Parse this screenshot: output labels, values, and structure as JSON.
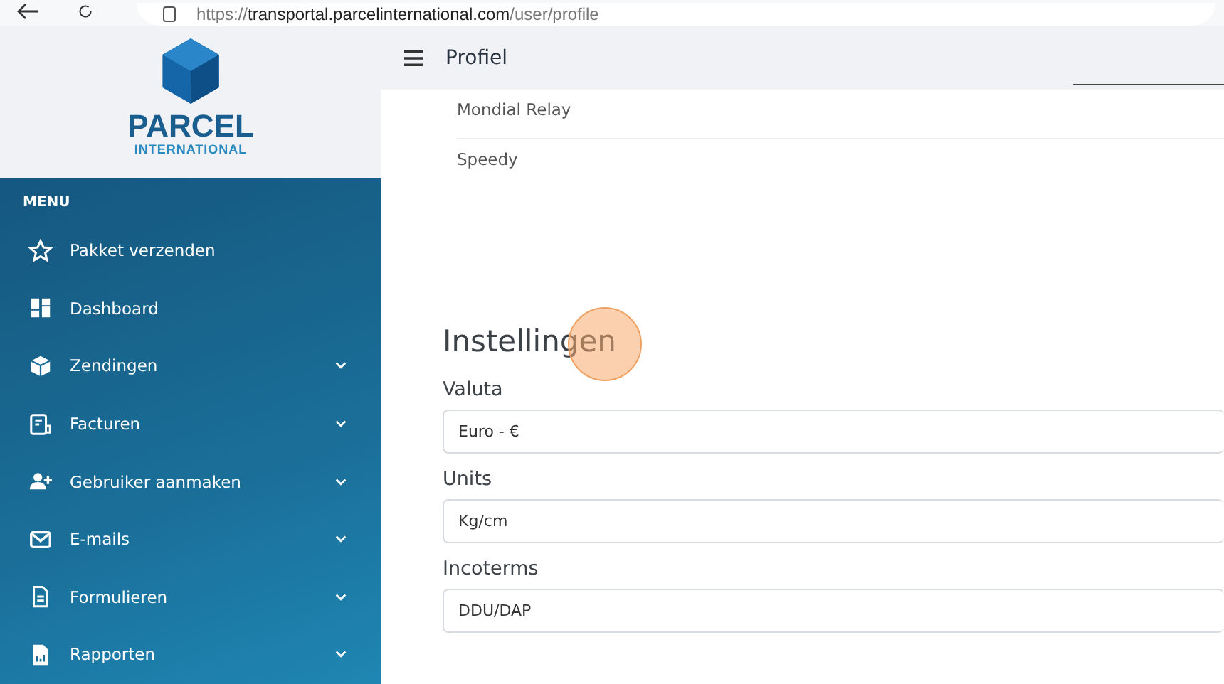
{
  "browser": {
    "url_muted_start": "https://",
    "url_host": "transportal.parcelinternational.com",
    "url_path": "/user/profile"
  },
  "logo": {
    "name": "PARCEL",
    "subtitle": "INTERNATIONAL"
  },
  "header": {
    "title": "Profiel"
  },
  "sidebar": {
    "heading": "MENU",
    "items": [
      {
        "label": "Pakket verzenden",
        "expandable": false
      },
      {
        "label": "Dashboard",
        "expandable": false
      },
      {
        "label": "Zendingen",
        "expandable": true
      },
      {
        "label": "Facturen",
        "expandable": true
      },
      {
        "label": "Gebruiker aanmaken",
        "expandable": true
      },
      {
        "label": "E-mails",
        "expandable": true
      },
      {
        "label": "Formulieren",
        "expandable": true
      },
      {
        "label": "Rapporten",
        "expandable": true
      }
    ]
  },
  "carriers": [
    "Mondial Relay",
    "Speedy"
  ],
  "settings": {
    "title": "Instellingen",
    "fields": [
      {
        "label": "Valuta",
        "value": "Euro - €"
      },
      {
        "label": "Units",
        "value": "Kg/cm"
      },
      {
        "label": "Incoterms",
        "value": "DDU/DAP"
      }
    ]
  }
}
